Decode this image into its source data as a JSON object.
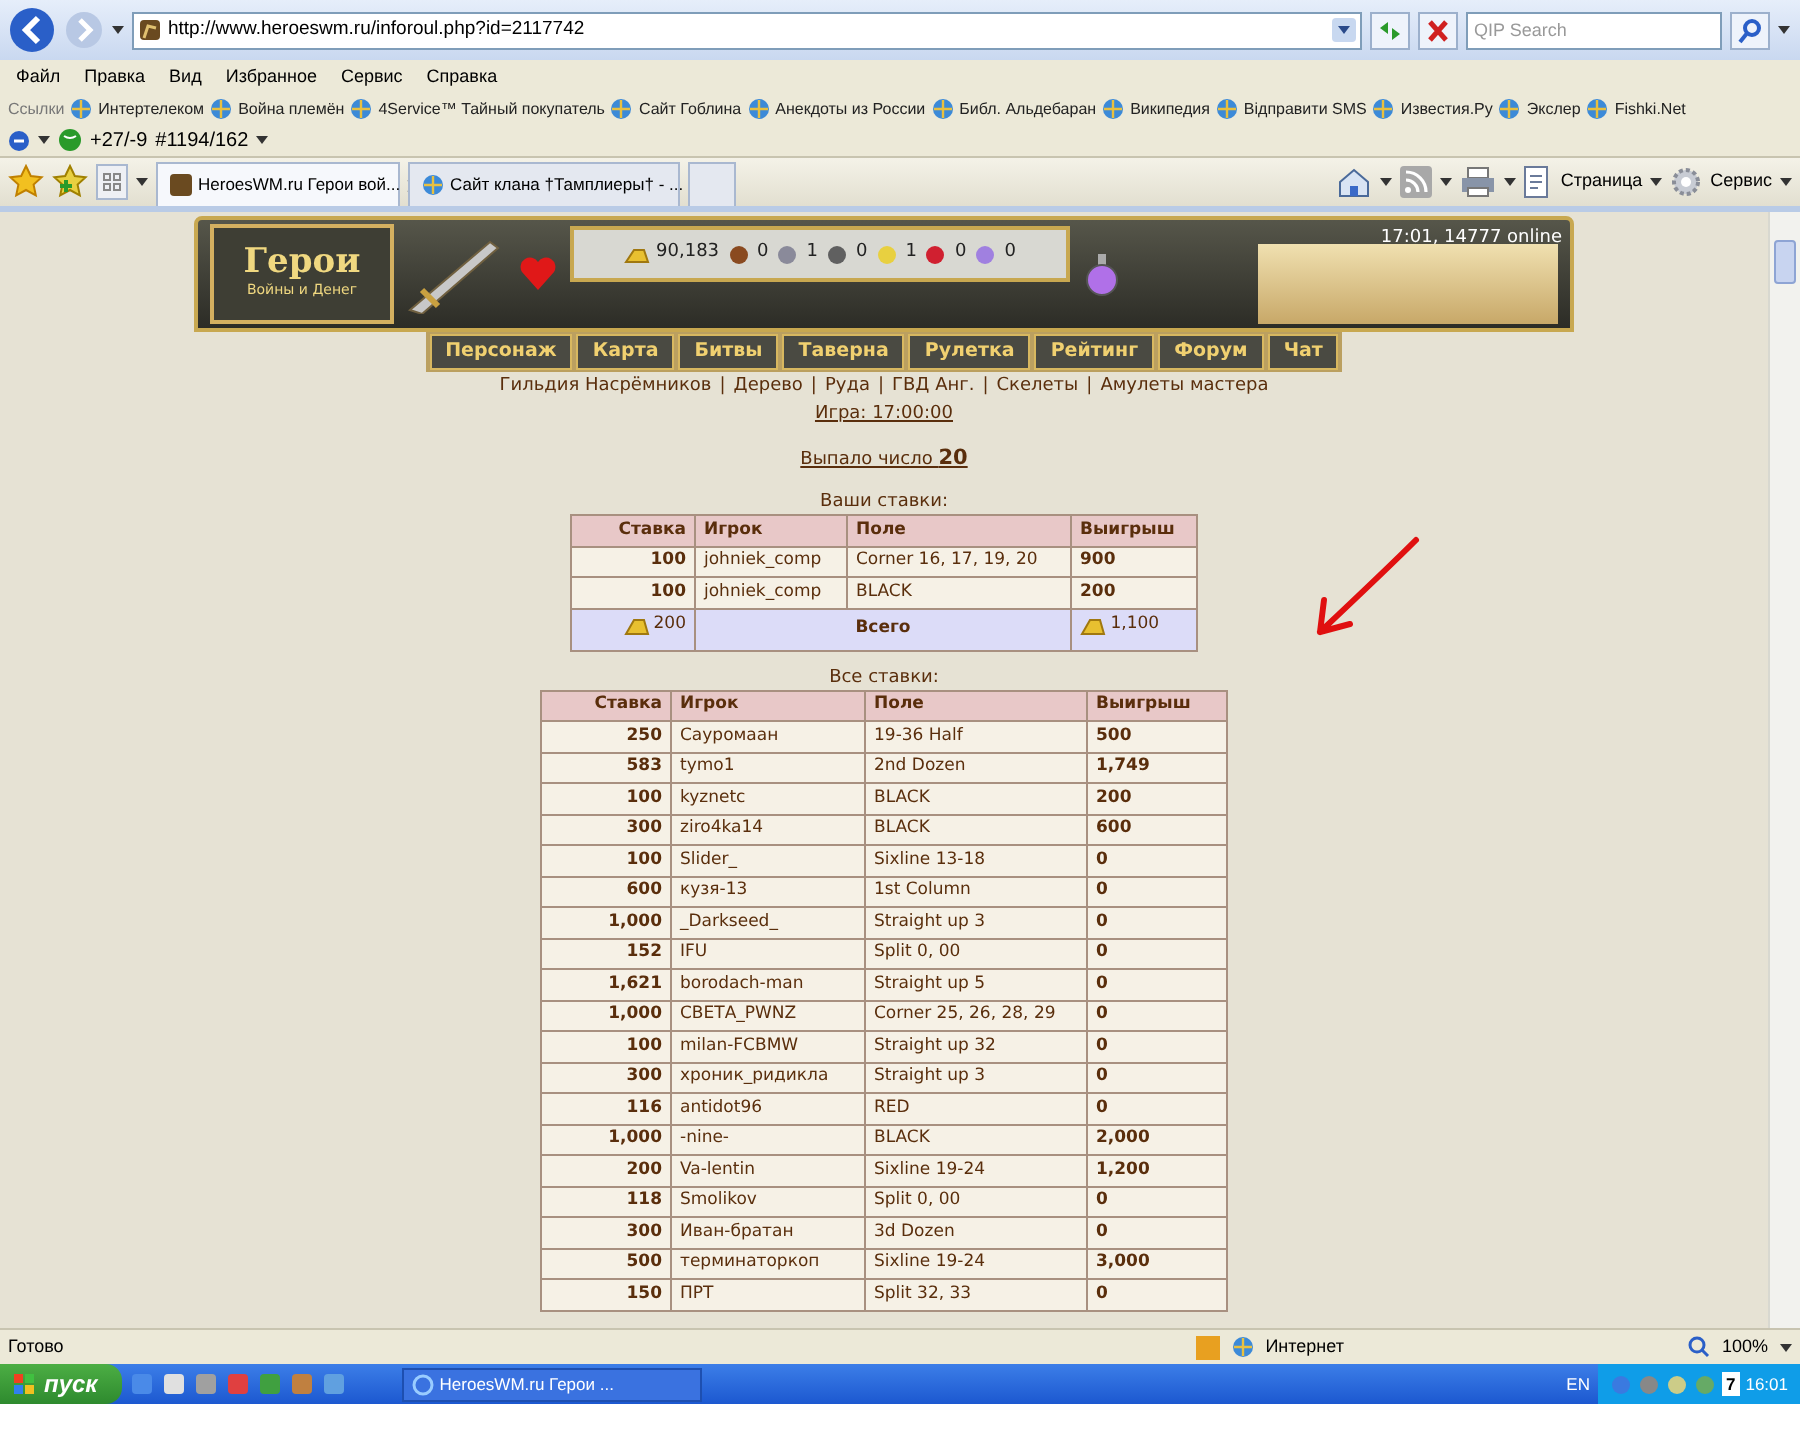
{
  "browser": {
    "address": "http://www.heroeswm.ru/inforoul.php?id=2117742",
    "search_placeholder": "QIP Search",
    "menu": [
      "Файл",
      "Правка",
      "Вид",
      "Избранное",
      "Сервис",
      "Справка"
    ],
    "links_label": "Ссылки",
    "links": [
      "Интертелеком",
      "Война племён",
      "4Service™ Тайный покупатель",
      "Сайт Гоблина",
      "Анекдоты из России",
      "Библ. Альдебаран",
      "Википедия",
      "Відправити SMS",
      "Известия.Ру",
      "Экслер",
      "Fishki.Net"
    ],
    "toolbar_texts": [
      "+27/-9",
      "#1194/162"
    ],
    "tabs": [
      {
        "label": "HeroesWM.ru Герои вой...",
        "selected": true
      },
      {
        "label": "Сайт клана †Тамплиеры† - ...",
        "selected": false
      }
    ],
    "commands": [
      "Страница",
      "Сервис"
    ]
  },
  "page": {
    "logo_title": "Герои",
    "logo_subtitle": "Войны и Денег",
    "online": "17:01, 14777 online",
    "resources": [
      "90,183",
      "0",
      "1",
      "0",
      "1",
      "0",
      "0"
    ],
    "nav": [
      "Персонаж",
      "Карта",
      "Битвы",
      "Таверна",
      "Рулетка",
      "Рейтинг",
      "Форум",
      "Чат"
    ],
    "sublinks": [
      "Гильдия Насрёмников",
      "Дерево",
      "Руда",
      "ГВД Анг.",
      "Скелеты",
      "Амулеты мастера"
    ],
    "separator": "|",
    "game_link": "Игра: 17:00:00",
    "result_label": "Выпало число",
    "result_number": "20",
    "my_bets": {
      "title": "Ваши ставки:",
      "columns": [
        "Ставка",
        "Игрок",
        "Поле",
        "Выигрыш"
      ],
      "rows": [
        [
          "100",
          "johniek_comp",
          "Corner 16, 17, 19, 20",
          "900"
        ],
        [
          "100",
          "johniek_comp",
          "BLACK",
          "200"
        ]
      ],
      "total": {
        "stake": "200",
        "label": "Всего",
        "win": "1,100"
      }
    },
    "all_bets": {
      "title": "Все ставки:",
      "columns": [
        "Ставка",
        "Игрок",
        "Поле",
        "Выигрыш"
      ],
      "rows": [
        [
          "250",
          "Сауромаан",
          "19-36 Half",
          "500"
        ],
        [
          "583",
          "tymo1",
          "2nd Dozen",
          "1,749"
        ],
        [
          "100",
          "kyznetc",
          "BLACK",
          "200"
        ],
        [
          "300",
          "ziro4ka14",
          "BLACK",
          "600"
        ],
        [
          "100",
          "Slider_",
          "Sixline 13-18",
          "0"
        ],
        [
          "600",
          "кузя-13",
          "1st Column",
          "0"
        ],
        [
          "1,000",
          "_Darkseed_",
          "Straight up 3",
          "0"
        ],
        [
          "152",
          "IFU",
          "Split 0, 00",
          "0"
        ],
        [
          "1,621",
          "borodach-man",
          "Straight up 5",
          "0"
        ],
        [
          "1,000",
          "СВЕТА_PWNZ",
          "Corner 25, 26, 28, 29",
          "0"
        ],
        [
          "100",
          "milan-FCBMW",
          "Straight up 32",
          "0"
        ],
        [
          "300",
          "хроник_ридикла",
          "Straight up 3",
          "0"
        ],
        [
          "116",
          "antidot96",
          "RED",
          "0"
        ],
        [
          "1,000",
          "-nine-",
          "BLACK",
          "2,000"
        ],
        [
          "200",
          "Va-lentin",
          "Sixline 19-24",
          "1,200"
        ],
        [
          "118",
          "Smolikov",
          "Split 0, 00",
          "0"
        ],
        [
          "300",
          "Иван-братан",
          "3d Dozen",
          "0"
        ],
        [
          "500",
          "терминаторкоп",
          "Sixline 19-24",
          "3,000"
        ],
        [
          "150",
          "ПРТ",
          "Split 32, 33",
          "0"
        ]
      ]
    }
  },
  "status_bar": {
    "text": "Готово",
    "zone": "Интернет",
    "zoom": "100%"
  },
  "taskbar": {
    "start": "пуск",
    "task": "HeroesWM.ru Герои ...",
    "lang": "EN",
    "tray_badge": "7",
    "clock": "16:01"
  }
}
